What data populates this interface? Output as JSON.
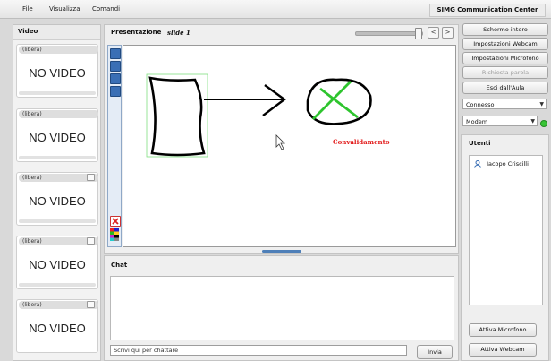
{
  "menu": {
    "items": [
      "File",
      "Visualizza",
      "Comandi"
    ]
  },
  "app": {
    "title": "SIMG Communication Center"
  },
  "video": {
    "title": "Video",
    "slots": [
      {
        "label": "(libera)",
        "text": "NO VIDEO"
      },
      {
        "label": "(libera)",
        "text": "NO VIDEO"
      },
      {
        "label": "(libera)",
        "text": "NO VIDEO"
      },
      {
        "label": "(libera)",
        "text": "NO VIDEO"
      },
      {
        "label": "(libera)",
        "text": "NO VIDEO"
      }
    ]
  },
  "presentation": {
    "title": "Presentazione",
    "slide": "slide 1",
    "prev_label": "<",
    "next_label": ">",
    "caption": "Convalidamento",
    "zoom_level": 0.9
  },
  "chat": {
    "title": "Chat",
    "input_value": "Scrivi qui per chattare",
    "send_label": "Invia"
  },
  "controls": {
    "fullscreen": "Schermo intero",
    "webcam_settings": "Impostazioni Webcam",
    "mic_settings": "Impostazioni Microfono",
    "request_word": "Richiesta parola",
    "leave": "Esci dall'Aula",
    "status_value": "Connesso",
    "connection_value": "Modem"
  },
  "users": {
    "title": "Utenti",
    "list": [
      "Iacopo Criscilli"
    ],
    "activate_mic": "Attiva Microfono",
    "activate_webcam": "Attiva Webcam"
  },
  "colors": {
    "accent": "#4e7fb8",
    "caption": "#e21b1b",
    "online": "#39c436"
  }
}
